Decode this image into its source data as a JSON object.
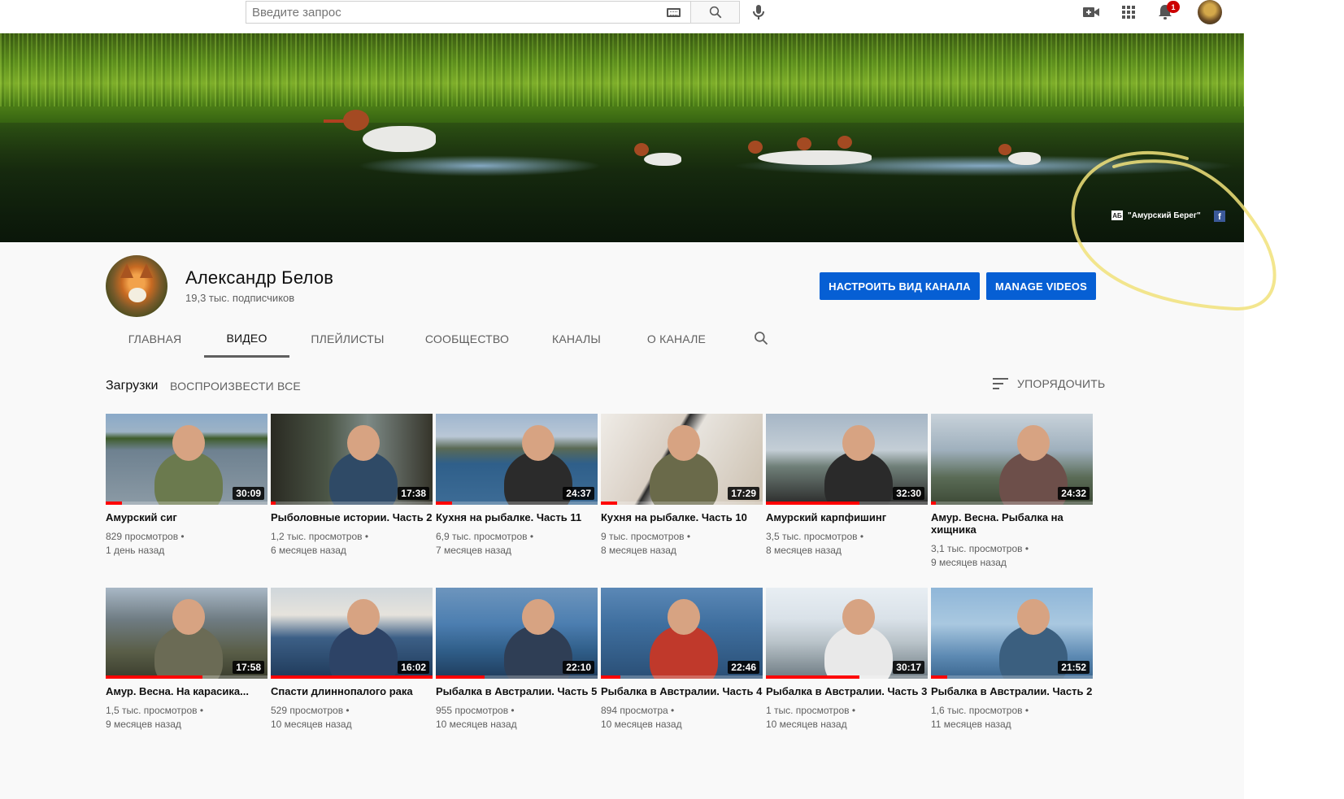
{
  "search": {
    "placeholder": "Введите запрос"
  },
  "notifications": {
    "count": "1"
  },
  "banner": {
    "link_text": "\"Амурский Берег\"",
    "logo_text": "АБ",
    "facebook_glyph": "f"
  },
  "channel": {
    "name": "Александр Белов",
    "subscribers": "19,3 тыс. подписчиков",
    "customize_button": "НАСТРОИТЬ ВИД КАНАЛА",
    "manage_button": "MANAGE VIDEOS"
  },
  "tabs": [
    {
      "label": "ГЛАВНАЯ",
      "active": false
    },
    {
      "label": "ВИДЕО",
      "active": true
    },
    {
      "label": "ПЛЕЙЛИСТЫ",
      "active": false
    },
    {
      "label": "СООБЩЕСТВО",
      "active": false
    },
    {
      "label": "КАНАЛЫ",
      "active": false
    },
    {
      "label": "О КАНАЛЕ",
      "active": false
    }
  ],
  "uploads": {
    "title": "Загрузки",
    "play_all": "ВОСПРОИЗВЕСТИ ВСЕ",
    "sort_label": "УПОРЯДОЧИТЬ"
  },
  "videos": [
    {
      "title": "Амурский сиг",
      "duration": "30:09",
      "views": "829 просмотров •",
      "age": "1 день назад",
      "watched": 0.1
    },
    {
      "title": "Рыболовные истории. Часть 2",
      "duration": "17:38",
      "views": "1,2 тыс. просмотров •",
      "age": "6 месяцев назад",
      "watched": 0.03
    },
    {
      "title": "Кухня на рыбалке. Часть 11",
      "duration": "24:37",
      "views": "6,9 тыс. просмотров •",
      "age": "7 месяцев назад",
      "watched": 0.1
    },
    {
      "title": "Кухня на рыбалке. Часть 10",
      "duration": "17:29",
      "views": "9 тыс. просмотров •",
      "age": "8 месяцев назад",
      "watched": 0.1
    },
    {
      "title": "Амурский карпфишинг",
      "duration": "32:30",
      "views": "3,5 тыс. просмотров •",
      "age": "8 месяцев назад",
      "watched": 0.58
    },
    {
      "title": "Амур. Весна. Рыбалка на хищника",
      "duration": "24:32",
      "views": "3,1 тыс. просмотров •",
      "age": "9 месяцев назад",
      "watched": 0.03
    },
    {
      "title": "Амур. Весна. На карасика...",
      "duration": "17:58",
      "views": "1,5 тыс. просмотров •",
      "age": "9 месяцев назад",
      "watched": 0.6
    },
    {
      "title": "Спасти длиннопалого рака",
      "duration": "16:02",
      "views": "529 просмотров •",
      "age": "10 месяцев назад",
      "watched": 1.0
    },
    {
      "title": "Рыбалка в Австралии. Часть 5",
      "duration": "22:10",
      "views": "955 просмотров •",
      "age": "10 месяцев назад",
      "watched": 0.3
    },
    {
      "title": "Рыбалка в Австралии. Часть 4",
      "duration": "22:46",
      "views": "894 просмотра •",
      "age": "10 месяцев назад",
      "watched": 0.12
    },
    {
      "title": "Рыбалка в Австралии. Часть 3",
      "duration": "30:17",
      "views": "1 тыс. просмотров •",
      "age": "10 месяцев назад",
      "watched": 0.58
    },
    {
      "title": "Рыбалка в Австралии. Часть 2",
      "duration": "21:52",
      "views": "1,6 тыс. просмотров •",
      "age": "11 месяцев назад",
      "watched": 0.1
    }
  ],
  "colors": {
    "accent_blue": "#065fd4",
    "progress_red": "#ff0000",
    "annotation_yellow": "#f1e27a"
  }
}
